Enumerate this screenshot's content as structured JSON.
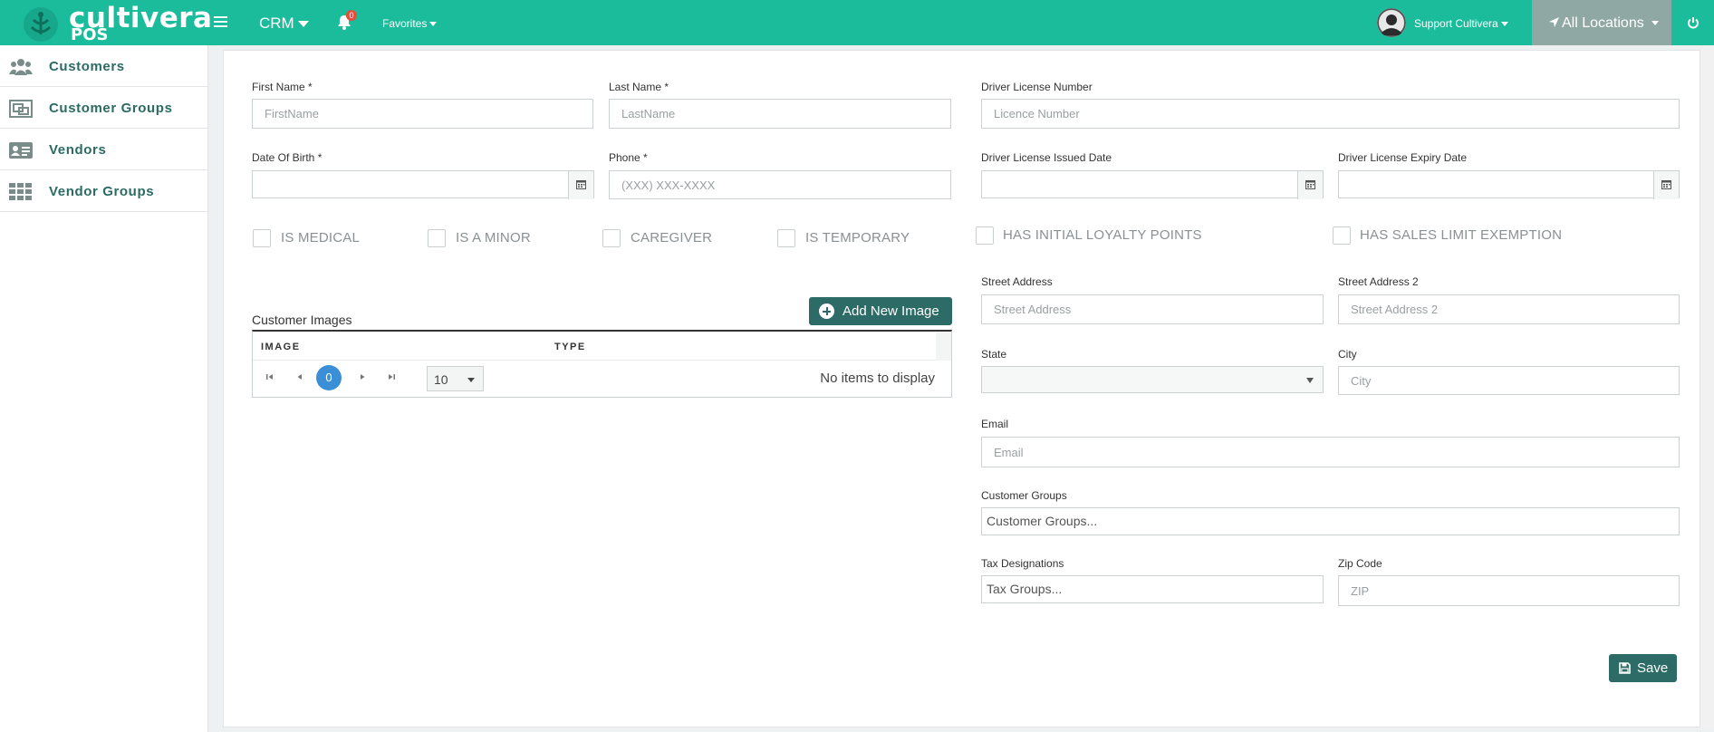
{
  "brand": {
    "name": "cultivera",
    "sub": "POS"
  },
  "topbar": {
    "module": "CRM",
    "notifications_count": "0",
    "favorites": "Favorites",
    "user_name": "Support Cultivera",
    "locations": "All Locations"
  },
  "sidebar": {
    "items": [
      {
        "label": "Customers",
        "icon": "users-icon"
      },
      {
        "label": "Customer Groups",
        "icon": "groups-icon"
      },
      {
        "label": "Vendors",
        "icon": "id-card-icon"
      },
      {
        "label": "Vendor Groups",
        "icon": "grid-icon"
      }
    ]
  },
  "form": {
    "first_name": {
      "label": "First Name *",
      "placeholder": "FirstName"
    },
    "last_name": {
      "label": "Last Name *",
      "placeholder": "LastName"
    },
    "dob": {
      "label": "Date Of Birth *"
    },
    "phone": {
      "label": "Phone *",
      "placeholder": "(XXX) XXX-XXXX"
    },
    "license_number": {
      "label": "Driver License Number",
      "placeholder": "Licence Number"
    },
    "license_issued": {
      "label": "Driver License Issued Date"
    },
    "license_expiry": {
      "label": "Driver License Expiry Date"
    },
    "checkboxes": {
      "is_medical": "IS MEDICAL",
      "is_minor": "IS A MINOR",
      "caregiver": "CAREGIVER",
      "is_temporary": "IS TEMPORARY",
      "initial_loyalty": "HAS INITIAL LOYALTY POINTS",
      "sales_limit": "HAS SALES LIMIT EXEMPTION"
    },
    "street": {
      "label": "Street Address",
      "placeholder": "Street Address"
    },
    "street2": {
      "label": "Street Address 2",
      "placeholder": "Street Address 2"
    },
    "state": {
      "label": "State"
    },
    "city": {
      "label": "City",
      "placeholder": "City"
    },
    "email": {
      "label": "Email",
      "placeholder": "Email"
    },
    "customer_groups": {
      "label": "Customer Groups",
      "placeholder": "Customer Groups..."
    },
    "tax": {
      "label": "Tax Designations",
      "placeholder": "Tax Groups..."
    },
    "zip": {
      "label": "Zip Code",
      "placeholder": "ZIP"
    },
    "save": "Save"
  },
  "images": {
    "title": "Customer Images",
    "add_button": "Add New Image",
    "columns": [
      "IMAGE",
      "TYPE"
    ],
    "page": "0",
    "page_size": "10",
    "empty": "No items to display"
  },
  "colors": {
    "topbar": "#1abc9c",
    "accent_dark": "#2c6b66",
    "pager_active": "#3a8fd6"
  }
}
